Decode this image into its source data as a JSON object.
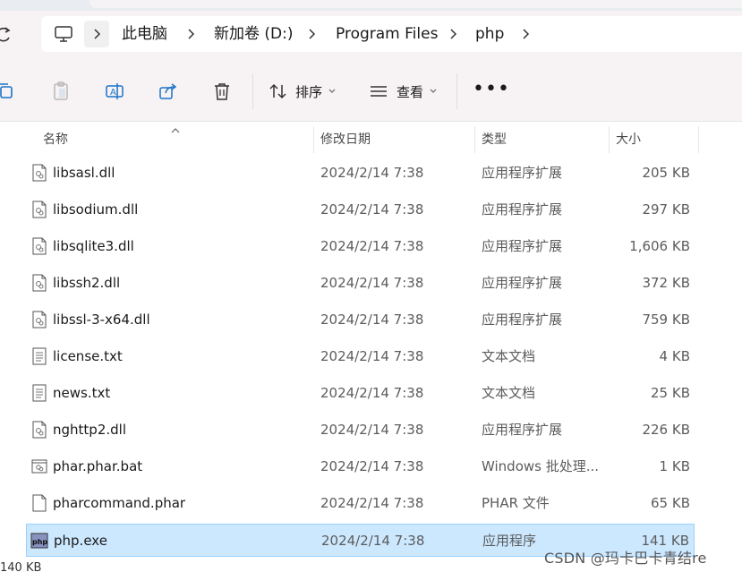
{
  "breadcrumb": {
    "items": [
      "此电脑",
      "新加卷 (D:)",
      "Program Files",
      "php"
    ]
  },
  "toolbar": {
    "sort_label": "排序",
    "view_label": "查看",
    "more_label": "•••"
  },
  "columns": {
    "name": "名称",
    "date": "修改日期",
    "type": "类型",
    "size": "大小"
  },
  "files": [
    {
      "name": "libsasl.dll",
      "date": "2024/2/14 7:38",
      "type": "应用程序扩展",
      "size": "205 KB",
      "icon": "dll-file-icon"
    },
    {
      "name": "libsodium.dll",
      "date": "2024/2/14 7:38",
      "type": "应用程序扩展",
      "size": "297 KB",
      "icon": "dll-file-icon"
    },
    {
      "name": "libsqlite3.dll",
      "date": "2024/2/14 7:38",
      "type": "应用程序扩展",
      "size": "1,606 KB",
      "icon": "dll-file-icon"
    },
    {
      "name": "libssh2.dll",
      "date": "2024/2/14 7:38",
      "type": "应用程序扩展",
      "size": "372 KB",
      "icon": "dll-file-icon"
    },
    {
      "name": "libssl-3-x64.dll",
      "date": "2024/2/14 7:38",
      "type": "应用程序扩展",
      "size": "759 KB",
      "icon": "dll-file-icon"
    },
    {
      "name": "license.txt",
      "date": "2024/2/14 7:38",
      "type": "文本文档",
      "size": "4 KB",
      "icon": "text-file-icon"
    },
    {
      "name": "news.txt",
      "date": "2024/2/14 7:38",
      "type": "文本文档",
      "size": "25 KB",
      "icon": "text-file-icon"
    },
    {
      "name": "nghttp2.dll",
      "date": "2024/2/14 7:38",
      "type": "应用程序扩展",
      "size": "226 KB",
      "icon": "dll-file-icon"
    },
    {
      "name": "phar.phar.bat",
      "date": "2024/2/14 7:38",
      "type": "Windows 批处理...",
      "size": "1 KB",
      "icon": "batch-file-icon"
    },
    {
      "name": "pharcommand.phar",
      "date": "2024/2/14 7:38",
      "type": "PHAR 文件",
      "size": "65 KB",
      "icon": "blank-file-icon"
    },
    {
      "name": "php.exe",
      "date": "2024/2/14 7:38",
      "type": "应用程序",
      "size": "141 KB",
      "icon": "php-exe-icon",
      "selected": true
    }
  ],
  "bottom_partial_text": "140 KB",
  "watermark": "CSDN @玛卡巴卡青结re",
  "colors": {
    "selection_bg": "#cce8ff",
    "selection_border": "#99d1ff",
    "chrome_bg": "#f7f2f4"
  }
}
